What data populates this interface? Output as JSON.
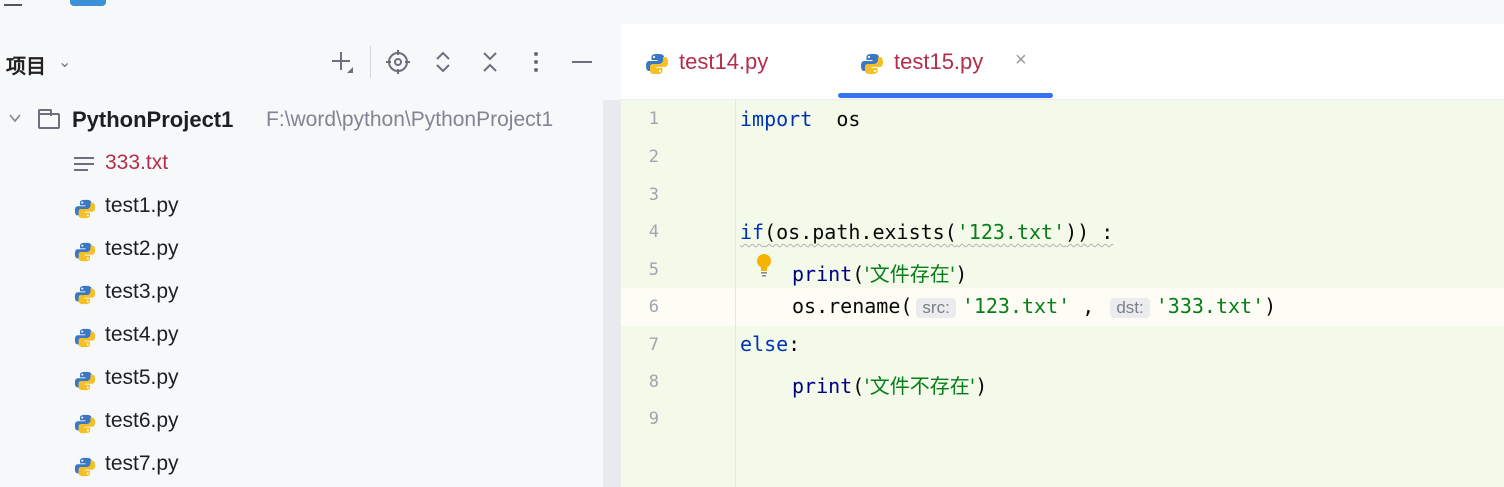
{
  "panel": {
    "title": "项目",
    "title_chevron": "⌄"
  },
  "tree": {
    "root": {
      "name": "PythonProject1",
      "path": "F:\\word\\python\\PythonProject1"
    },
    "files": [
      {
        "name": "333.txt",
        "type": "text",
        "color": "#b22e4a"
      },
      {
        "name": "test1.py",
        "type": "python"
      },
      {
        "name": "test2.py",
        "type": "python"
      },
      {
        "name": "test3.py",
        "type": "python"
      },
      {
        "name": "test4.py",
        "type": "python"
      },
      {
        "name": "test5.py",
        "type": "python"
      },
      {
        "name": "test6.py",
        "type": "python"
      },
      {
        "name": "test7.py",
        "type": "python"
      }
    ]
  },
  "tabs": [
    {
      "label": "test14.py",
      "active": false,
      "color": "#b22e4a"
    },
    {
      "label": "test15.py",
      "active": true,
      "color": "#b22e4a",
      "close": "×"
    }
  ],
  "editor": {
    "line_numbers": [
      "1",
      "2",
      "3",
      "4",
      "5",
      "6",
      "7",
      "8",
      "9"
    ],
    "lines": {
      "l1_kw": "import",
      "l1_mod": "os",
      "l4_kw": "if",
      "l4_code": "(os.path.exists(",
      "l4_str": "'123.txt'",
      "l4_end": ")) :",
      "l5_fn": "print",
      "l5_open": "(",
      "l5_str": "'文件存在'",
      "l5_close": ")",
      "l6_code": "os.rename(",
      "l6_hint1": "src:",
      "l6_str1": "'123.txt'",
      "l6_comma": " ,",
      "l6_hint2": "dst:",
      "l6_str2": "'333.txt'",
      "l6_close": ")",
      "l7_kw": "else",
      "l7_colon": ":",
      "l8_fn": "print",
      "l8_open": "(",
      "l8_str": "'文件不存在'",
      "l8_close": ")"
    }
  },
  "colors": {
    "editor_bg": "#f3fae9",
    "keyword": "#0033b3",
    "string": "#067d17",
    "accent": "#3574f0"
  }
}
